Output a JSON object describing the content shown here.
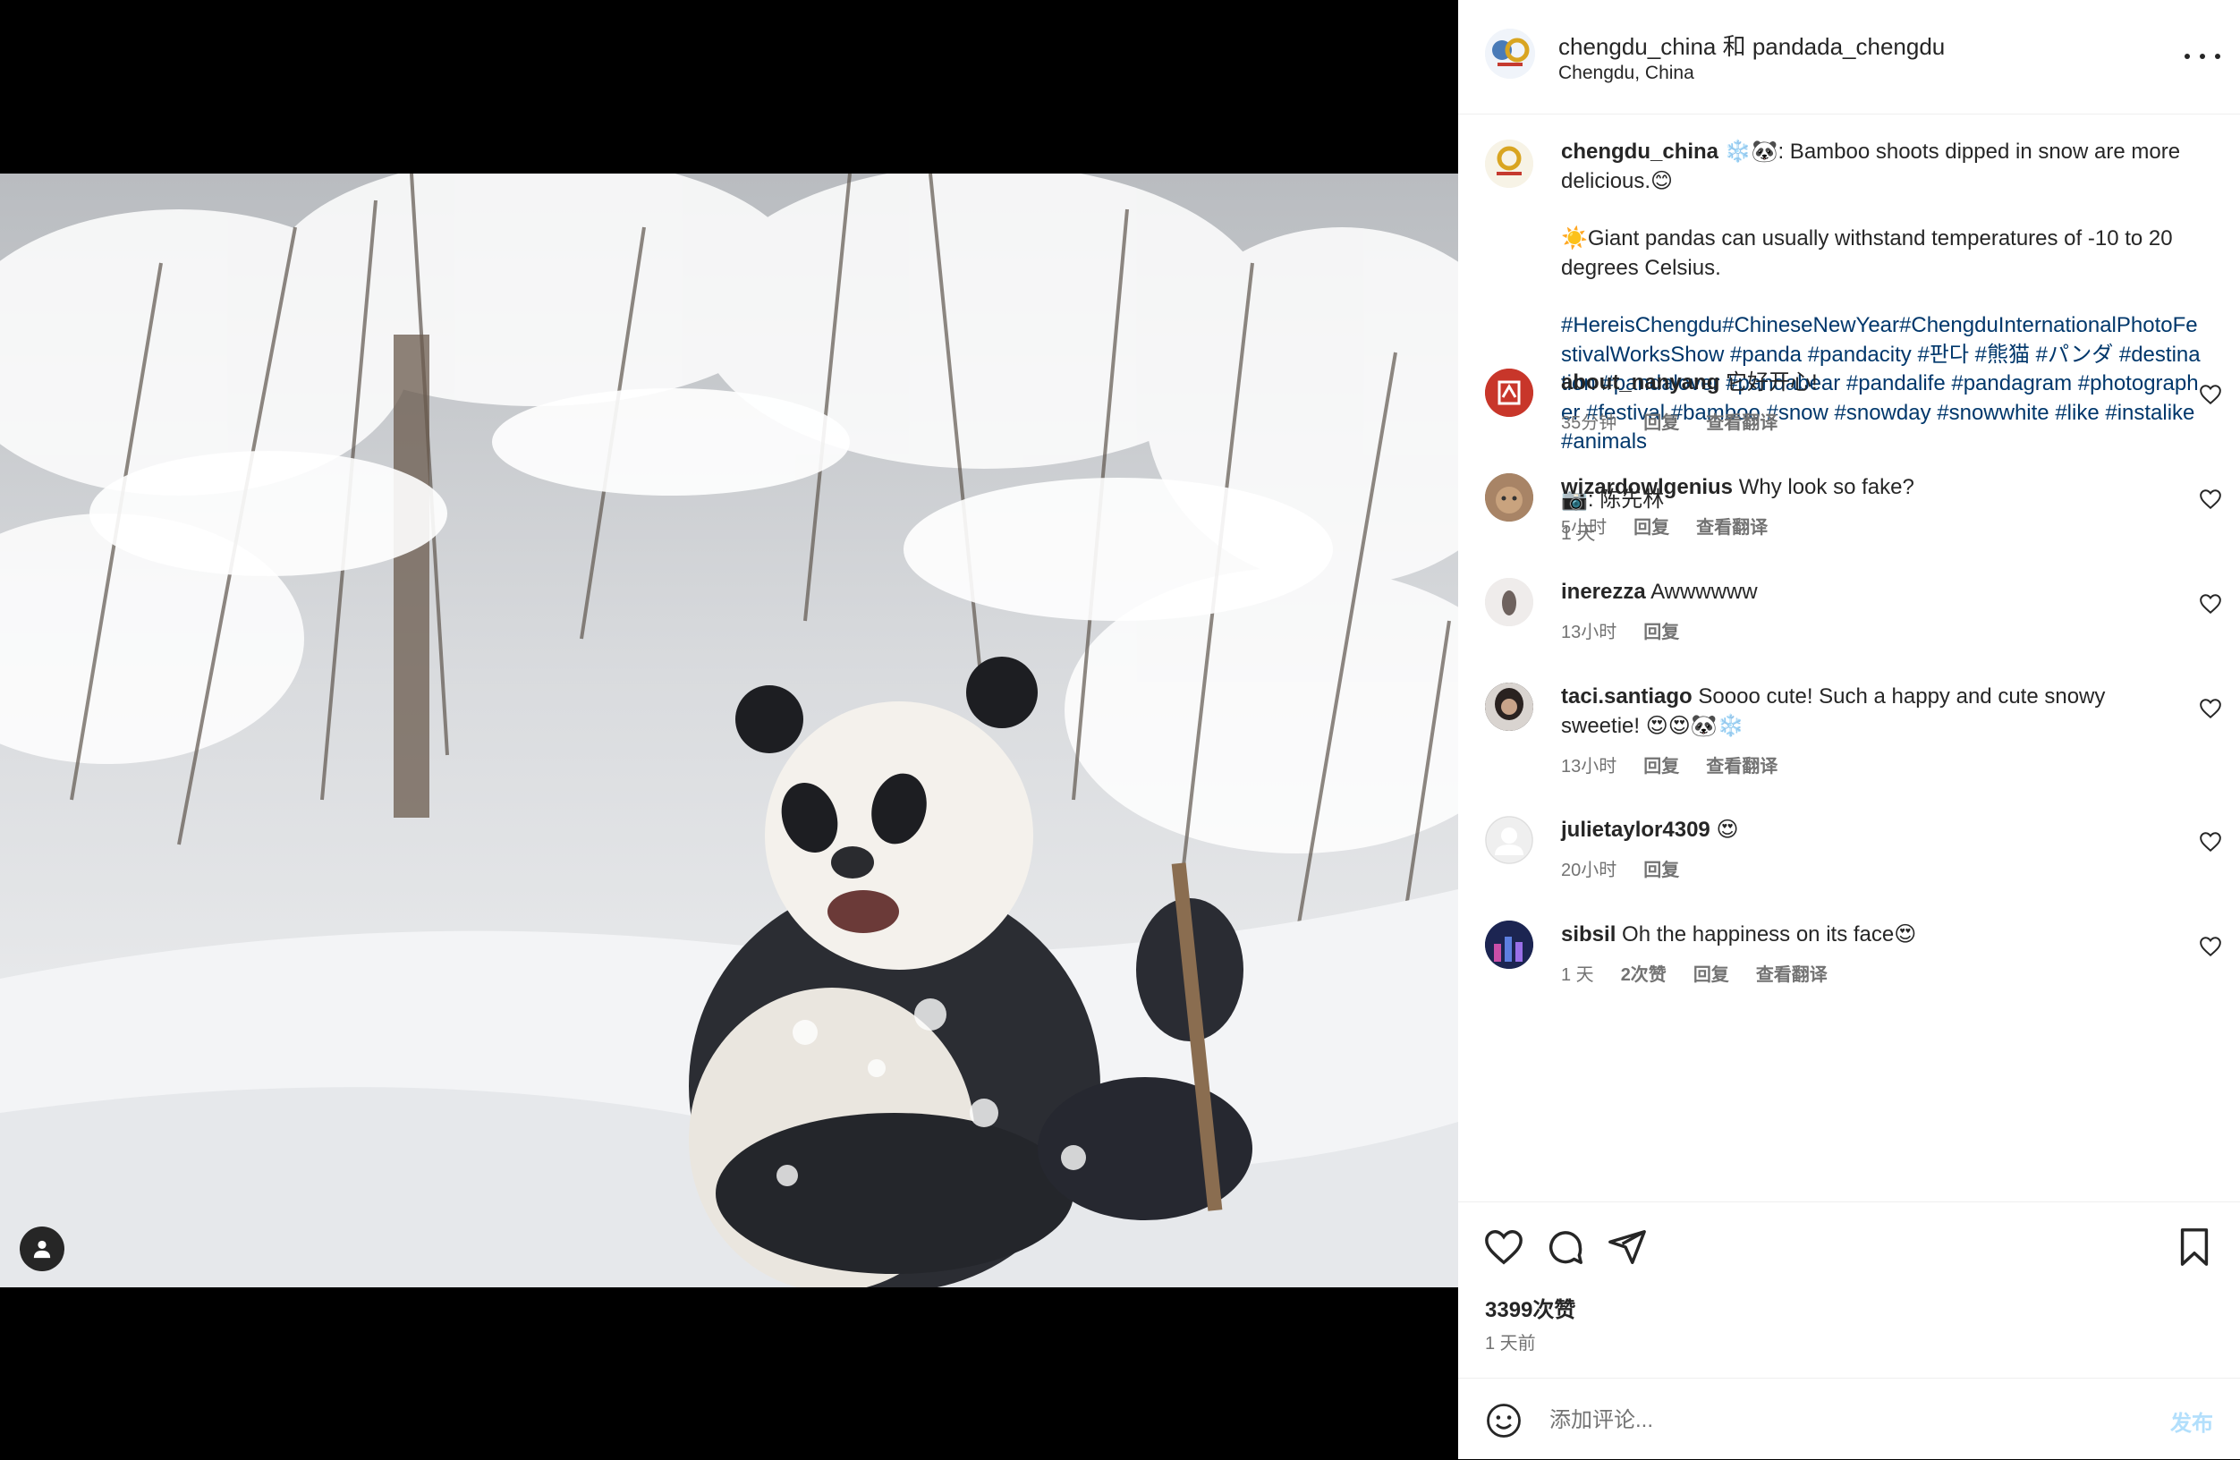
{
  "post": {
    "authors": "chengdu_china 和 pandada_chengdu",
    "location": "Chengdu, China",
    "caption": {
      "username": "chengdu_china",
      "line1": "❄️🐼: Bamboo shoots dipped in snow are more delicious.😊",
      "line2": "☀️Giant pandas can usually withstand temperatures of -10 to 20 degrees Celsius.",
      "hashtags": "#HereisChengdu#ChineseNewYear#ChengduInternationalPhotoFestivalWorksShow #panda #pandacity #판다 #熊猫 #パンダ #destination #pandalover #pandabear #pandalife #pandagram #photographer #festival #bamboo #snow #snowday #snowwhite #like #instalike #animals",
      "credit": "📷: 陈先林",
      "time": "1 天"
    },
    "comments": [
      {
        "username": "about_nanyang",
        "text": "它好开心!",
        "time": "35分钟",
        "likes": "",
        "reply": "回复",
        "translate": "查看翻译"
      },
      {
        "username": "wizardowlgenius",
        "text": "Why look so fake?",
        "time": "5小时",
        "likes": "",
        "reply": "回复",
        "translate": "查看翻译"
      },
      {
        "username": "inerezza",
        "text": "Awwwwww",
        "time": "13小时",
        "likes": "",
        "reply": "回复",
        "translate": ""
      },
      {
        "username": "taci.santiago",
        "text": "Soooo cute! Such a happy and cute snowy sweetie! 😍😍🐼❄️",
        "time": "13小时",
        "likes": "",
        "reply": "回复",
        "translate": "查看翻译"
      },
      {
        "username": "julietaylor4309",
        "text": "😍",
        "time": "20小时",
        "likes": "",
        "reply": "回复",
        "translate": ""
      },
      {
        "username": "sibsil",
        "text": "Oh the happiness on its face😍",
        "time": "1 天",
        "likes": "2次赞",
        "reply": "回复",
        "translate": "查看翻译"
      }
    ],
    "likes_count": "3399次赞",
    "posted_time": "1 天前",
    "comment_placeholder": "添加评论...",
    "post_button": "发布"
  },
  "colors": {
    "link": "#00376b",
    "secondary": "#737373",
    "post_button": "#b2dffc"
  }
}
